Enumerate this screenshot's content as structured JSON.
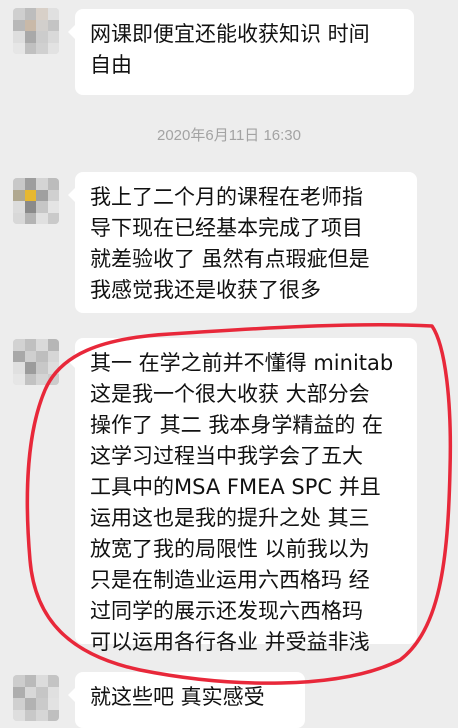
{
  "conversation": {
    "timestamp": "2020年6月11日 16:30",
    "messages": [
      {
        "lines": [
          "网课即便宜还能收获知识 时间",
          "自由"
        ]
      },
      {
        "lines": [
          "我上了二个月的课程在老师指",
          "导下现在已经基本完成了项目",
          "就差验收了 虽然有点瑕疵但是",
          "我感觉我还是收获了很多"
        ]
      },
      {
        "lines": [
          "其一 在学之前并不懂得 minitab",
          " 这是我一个很大收获 大部分会",
          "操作了 其二 我本身学精益的 在",
          "这学习过程当中我学会了五大",
          "工具中的MSA FMEA SPC 并且",
          "运用这也是我的提升之处 其三",
          "放宽了我的局限性 以前我以为",
          "只是在制造业运用六西格玛 经",
          "过同学的展示还发现六西格玛",
          "可以运用各行各业 并受益非浅"
        ]
      },
      {
        "lines": [
          "就这些吧 真实感受"
        ]
      }
    ]
  },
  "colors": {
    "background": "#ededed",
    "bubble": "#ffffff",
    "text": "#111111",
    "timestamp": "#a3a3a3",
    "annotation_circle": "#e8283a"
  }
}
